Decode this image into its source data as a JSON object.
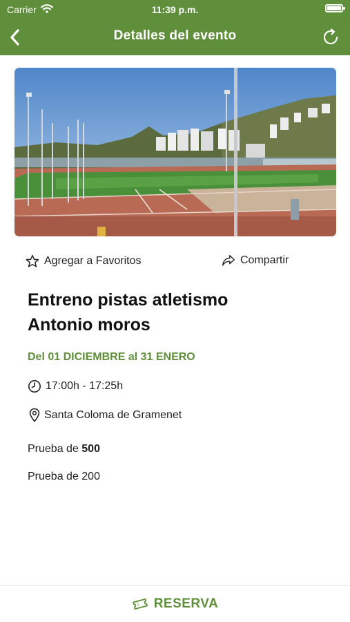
{
  "status_bar": {
    "carrier": "Carrier",
    "time": "11:39 p.m."
  },
  "nav": {
    "title": "Detalles del evento"
  },
  "event": {
    "image_alt": "athletics-stadium-photo",
    "actions": {
      "favorite_label": "Agregar a Favoritos",
      "share_label": "Compartir"
    },
    "title_line1": "Entreno pistas atletismo",
    "title_line2": "Antonio moros",
    "dates": "Del 01 DICIEMBRE al 31 ENERO",
    "time": "17:00h - 17:25h",
    "location": "Santa Coloma de Gramenet",
    "tests": [
      {
        "prefix": "Prueba de ",
        "value": "500"
      },
      {
        "prefix": "Prueba de ",
        "value": "200"
      }
    ]
  },
  "footer": {
    "reserve_label": "RESERVA"
  },
  "colors": {
    "brand_green": "#5f8f3a",
    "header_text": "#ffffff"
  },
  "icons": {
    "back": "chevron-left-icon",
    "refresh": "refresh-icon",
    "favorite": "star-outline-icon",
    "share": "share-arrow-icon",
    "clock": "clock-icon",
    "location": "location-pin-icon",
    "ticket": "ticket-icon",
    "wifi": "wifi-icon",
    "battery": "battery-icon"
  }
}
